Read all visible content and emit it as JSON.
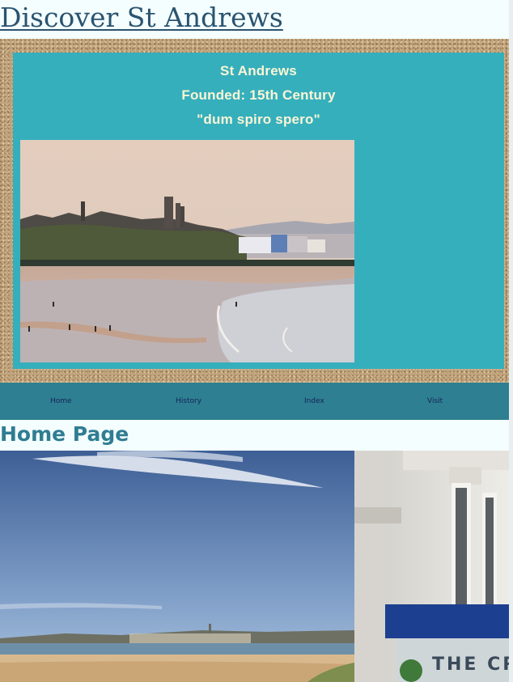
{
  "header": {
    "title": "Discover St Andrews"
  },
  "hero": {
    "line1": "St Andrews",
    "line2": "Founded: 15th Century",
    "line3": "\"dum spiro spero\""
  },
  "nav": {
    "items": [
      {
        "label": "Home"
      },
      {
        "label": "History"
      },
      {
        "label": "Index"
      },
      {
        "label": "Visit"
      }
    ]
  },
  "main": {
    "heading": "Home Page",
    "storefront_sign": "THE CRYS"
  },
  "colors": {
    "background": "#f4fefe",
    "hero_panel": "#36afbd",
    "nav_bar": "#2e7f91",
    "title": "#2a5470",
    "heading": "#2f7d92",
    "hero_text": "#fbf6d5"
  }
}
